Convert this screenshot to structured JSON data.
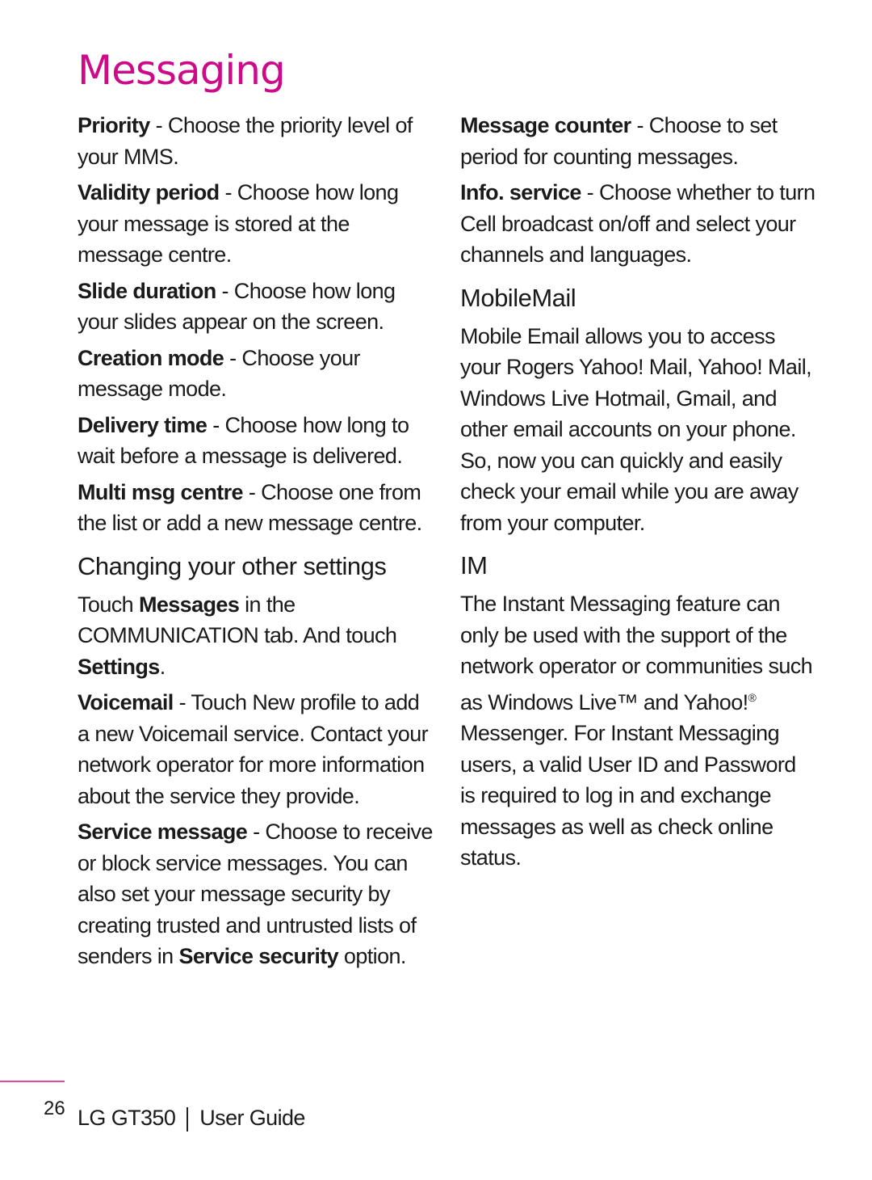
{
  "page": {
    "title": "Messaging",
    "accent_color": "#cc0a8a",
    "page_number": "26",
    "footer_product": "LG GT350",
    "footer_guide": "User Guide"
  },
  "left": {
    "items": [
      {
        "term": "Priority",
        "desc": " - Choose the priority level of your MMS."
      },
      {
        "term": "Validity period",
        "desc": " - Choose how long your message is stored at the message centre."
      },
      {
        "term": "Slide duration",
        "desc": " - Choose how long your slides appear on the screen."
      },
      {
        "term": "Creation mode",
        "desc": " - Choose your message mode."
      },
      {
        "term": "Delivery time",
        "desc": " - Choose how long to wait before a message is delivered."
      },
      {
        "term": "Multi msg centre",
        "desc": " - Choose one from the list or add a new message centre."
      }
    ],
    "section_heading": "Changing your other settings",
    "intro": {
      "t1": "Touch ",
      "b1": "Messages",
      "t2": " in the COMMUNICATION tab. And touch ",
      "b2": "Settings",
      "t3": "."
    },
    "items2": [
      {
        "term": "Voicemail",
        "desc": " - Touch New profile to add a new Voicemail service. Contact your network operator for more information about the service they provide."
      }
    ],
    "service": {
      "term": "Service message",
      "desc": " - Choose to receive or block service messages. You can also set your message security by creating trusted and untrusted lists of senders in ",
      "bold2": "Service security",
      "end": " option."
    }
  },
  "right": {
    "items": [
      {
        "term": "Message counter",
        "desc": " - Choose to set period for counting messages."
      },
      {
        "term": "Info. service",
        "desc": " - Choose whether to turn Cell broadcast on/off and select your channels and languages."
      }
    ],
    "mobilemail_heading": "MobileMail",
    "mobilemail_text": "Mobile Email allows you to access your Rogers Yahoo! Mail, Yahoo! Mail, Windows Live Hotmail, Gmail, and other email accounts on your phone. So, now you can quickly and easily check your email while you are away from your computer.",
    "im_heading": "IM",
    "im_text1": "The Instant Messaging feature can only be used with the support of the network operator or communities such as Windows Live™ and Yahoo!",
    "im_reg": "®",
    "im_text2": " Messenger. For Instant Messaging users, a valid User ID and Password is required to log in and exchange messages as well as check online status."
  }
}
